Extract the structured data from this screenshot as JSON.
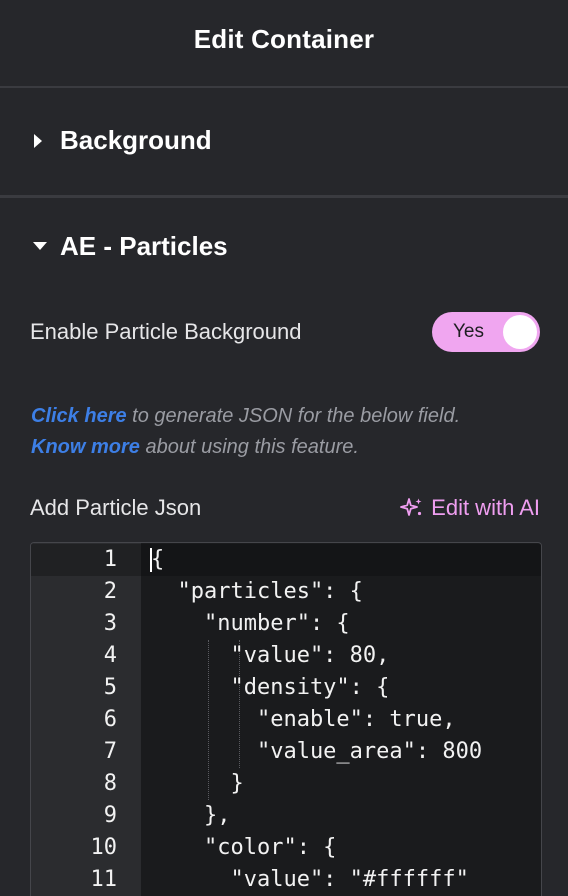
{
  "header": {
    "title": "Edit Container"
  },
  "sections": {
    "background": {
      "title": "Background",
      "expanded": false
    },
    "particles": {
      "title": "AE - Particles",
      "expanded": true
    }
  },
  "enable_particle": {
    "label": "Enable Particle Background",
    "value": "Yes",
    "on": true
  },
  "help": {
    "link1": "Click here",
    "text1": " to generate JSON for the below field.",
    "link2": "Know more",
    "text2": " about using this feature."
  },
  "json_field": {
    "label": "Add Particle Json",
    "ai_button": "Edit with AI"
  },
  "editor": {
    "lines": [
      {
        "n": "1",
        "text": "{"
      },
      {
        "n": "2",
        "text": "  \"particles\": {"
      },
      {
        "n": "3",
        "text": "    \"number\": {"
      },
      {
        "n": "4",
        "text": "      \"value\": 80,"
      },
      {
        "n": "5",
        "text": "      \"density\": {"
      },
      {
        "n": "6",
        "text": "        \"enable\": true,"
      },
      {
        "n": "7",
        "text": "        \"value_area\": 800"
      },
      {
        "n": "8",
        "text": "      }"
      },
      {
        "n": "9",
        "text": "    },"
      },
      {
        "n": "10",
        "text": "    \"color\": {"
      },
      {
        "n": "11",
        "text": "      \"value\": \"#ffffff\""
      }
    ]
  },
  "colors": {
    "panel_bg": "#26272b",
    "accent_pink": "#f0a6f0",
    "link_blue": "#3d7fe6"
  }
}
